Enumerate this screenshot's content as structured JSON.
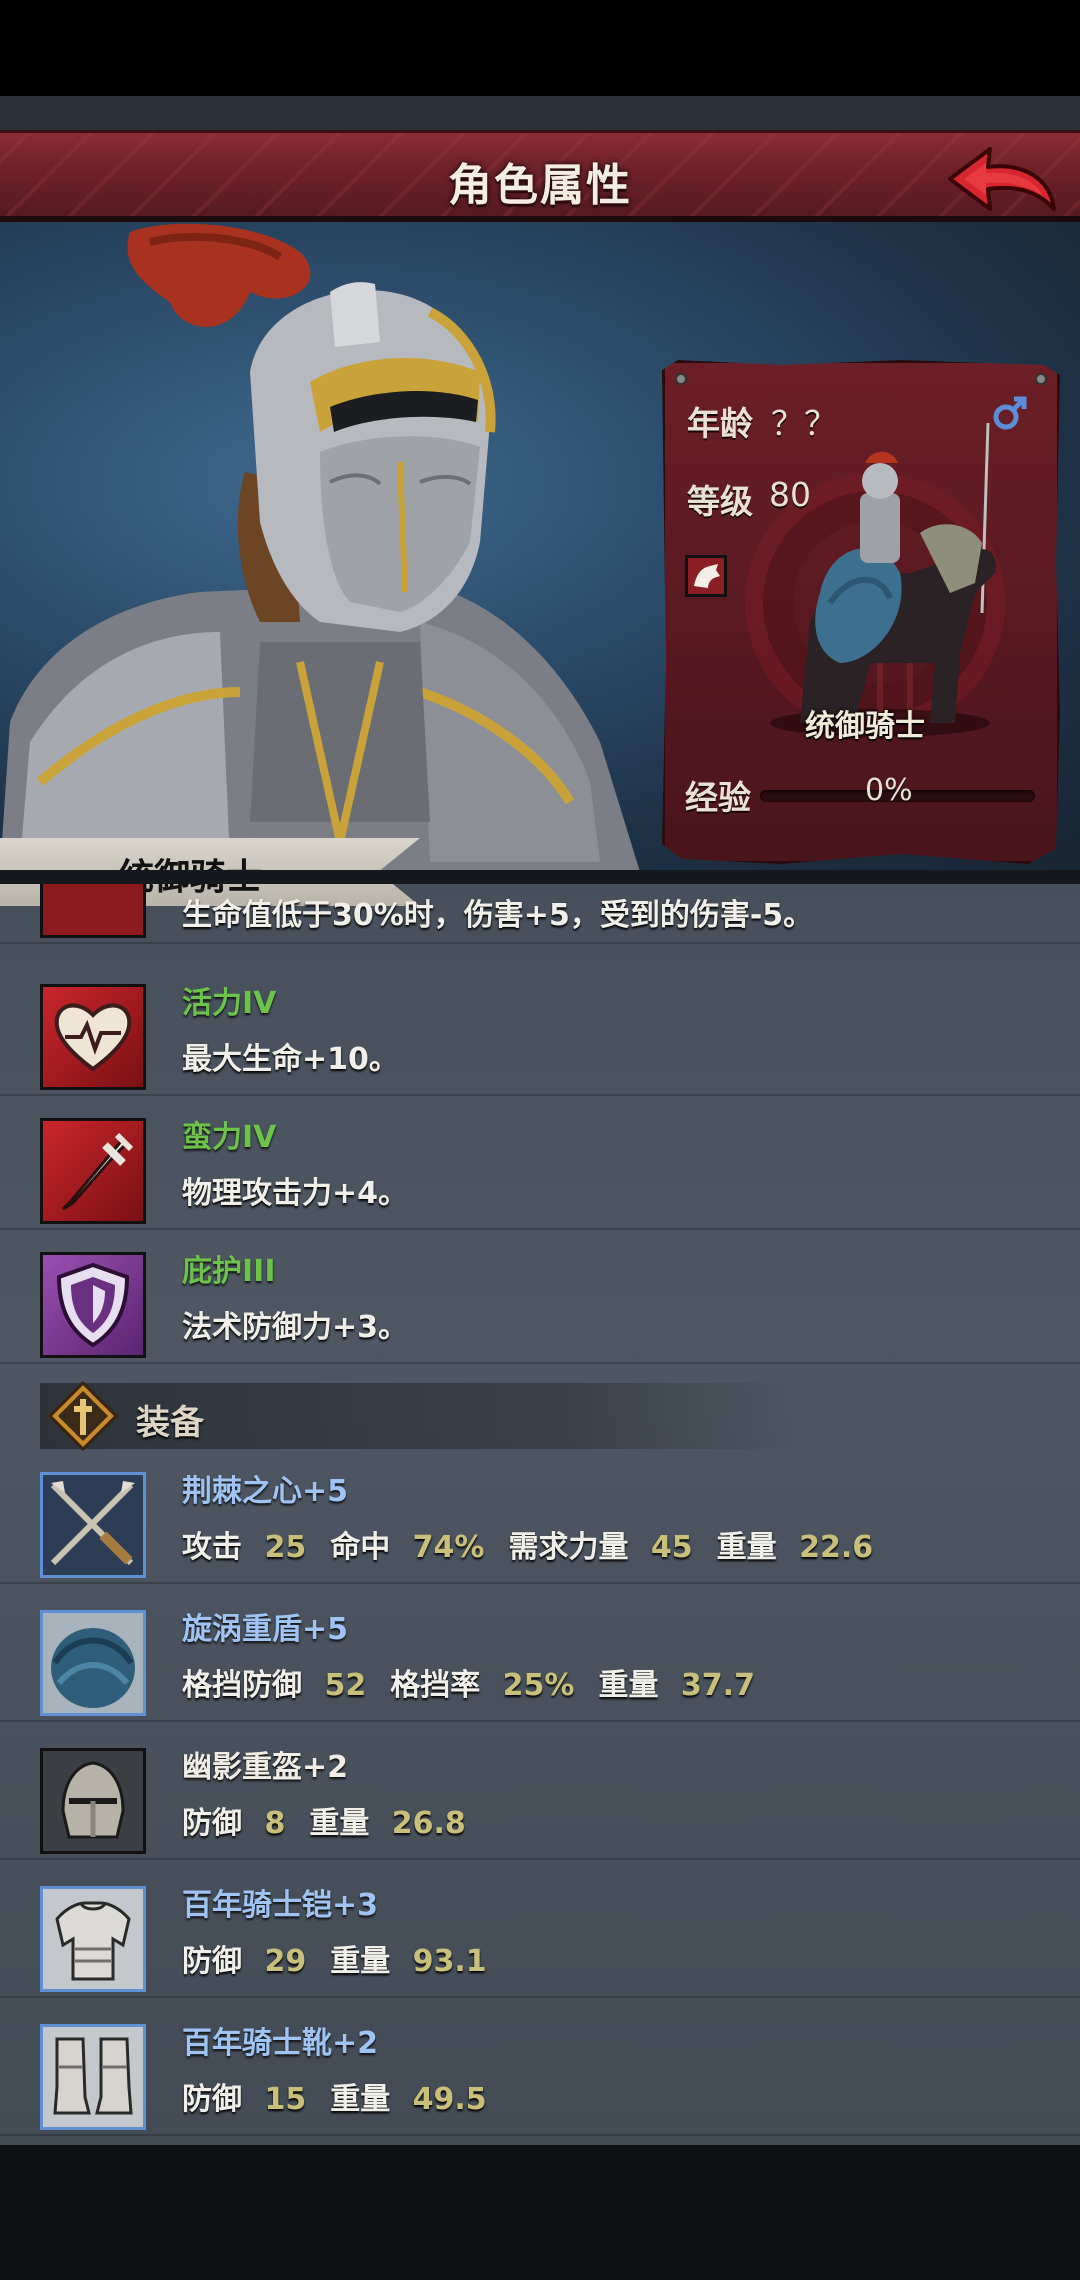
{
  "header": {
    "title": "角色属性"
  },
  "character": {
    "name": "统御骑士",
    "age_label": "年龄",
    "age_value": "？？",
    "level_label": "等级",
    "level_value": "80",
    "unit_name": "统御骑士",
    "exp_label": "经验",
    "exp_value": "0%",
    "exp_fraction": 0
  },
  "traits": [
    {
      "name": "",
      "desc": "生命值低于30%时，伤害+5，受到的伤害-5。",
      "icon": "skull-icon"
    },
    {
      "name": "活力IV",
      "desc": "最大生命+10。",
      "icon": "heart-icon"
    },
    {
      "name": "蛮力IV",
      "desc": "物理攻击力+4。",
      "icon": "sword-icon"
    },
    {
      "name": "庇护III",
      "desc": "法术防御力+3。",
      "icon": "shield-icon"
    }
  ],
  "equipment_section": {
    "title": "装备"
  },
  "equipment": [
    {
      "name": "荆棘之心+5",
      "stats": [
        [
          "攻击",
          "25"
        ],
        [
          "命中",
          "74%"
        ],
        [
          "需求力量",
          "45"
        ],
        [
          "重量",
          "22.6"
        ]
      ],
      "icon": "crossed-lances-icon"
    },
    {
      "name": "旋涡重盾+5",
      "stats": [
        [
          "格挡防御",
          "52"
        ],
        [
          "格挡率",
          "25%"
        ],
        [
          "重量",
          "37.7"
        ]
      ],
      "icon": "feather-shield-icon"
    },
    {
      "name": "幽影重盔+2",
      "stats": [
        [
          "防御",
          "8"
        ],
        [
          "重量",
          "26.8"
        ]
      ],
      "icon": "helmet-icon"
    },
    {
      "name": "百年骑士铠+3",
      "stats": [
        [
          "防御",
          "29"
        ],
        [
          "重量",
          "93.1"
        ]
      ],
      "icon": "armor-icon"
    },
    {
      "name": "百年骑士靴+2",
      "stats": [
        [
          "防御",
          "15"
        ],
        [
          "重量",
          "49.5"
        ]
      ],
      "icon": "boots-icon"
    }
  ]
}
